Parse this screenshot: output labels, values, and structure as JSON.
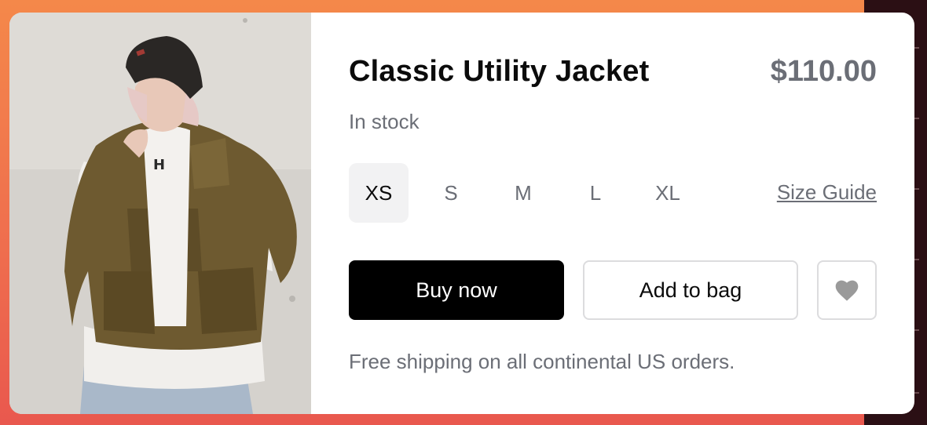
{
  "product": {
    "title": "Classic Utility Jacket",
    "price": "$110.00",
    "stock_status": "In stock",
    "sizes": [
      "XS",
      "S",
      "M",
      "L",
      "XL"
    ],
    "selected_size": "XS",
    "size_guide_label": "Size Guide",
    "buy_now_label": "Buy now",
    "add_to_bag_label": "Add to bag",
    "favorite_icon": "heart-icon",
    "shipping_note": "Free shipping on all continental US orders."
  },
  "colors": {
    "background_gradient": [
      "#f4884a",
      "#e9584e"
    ],
    "primary_button": "#000000",
    "muted_text": "#6b6e76",
    "selected_size_bg": "#f2f2f3"
  }
}
